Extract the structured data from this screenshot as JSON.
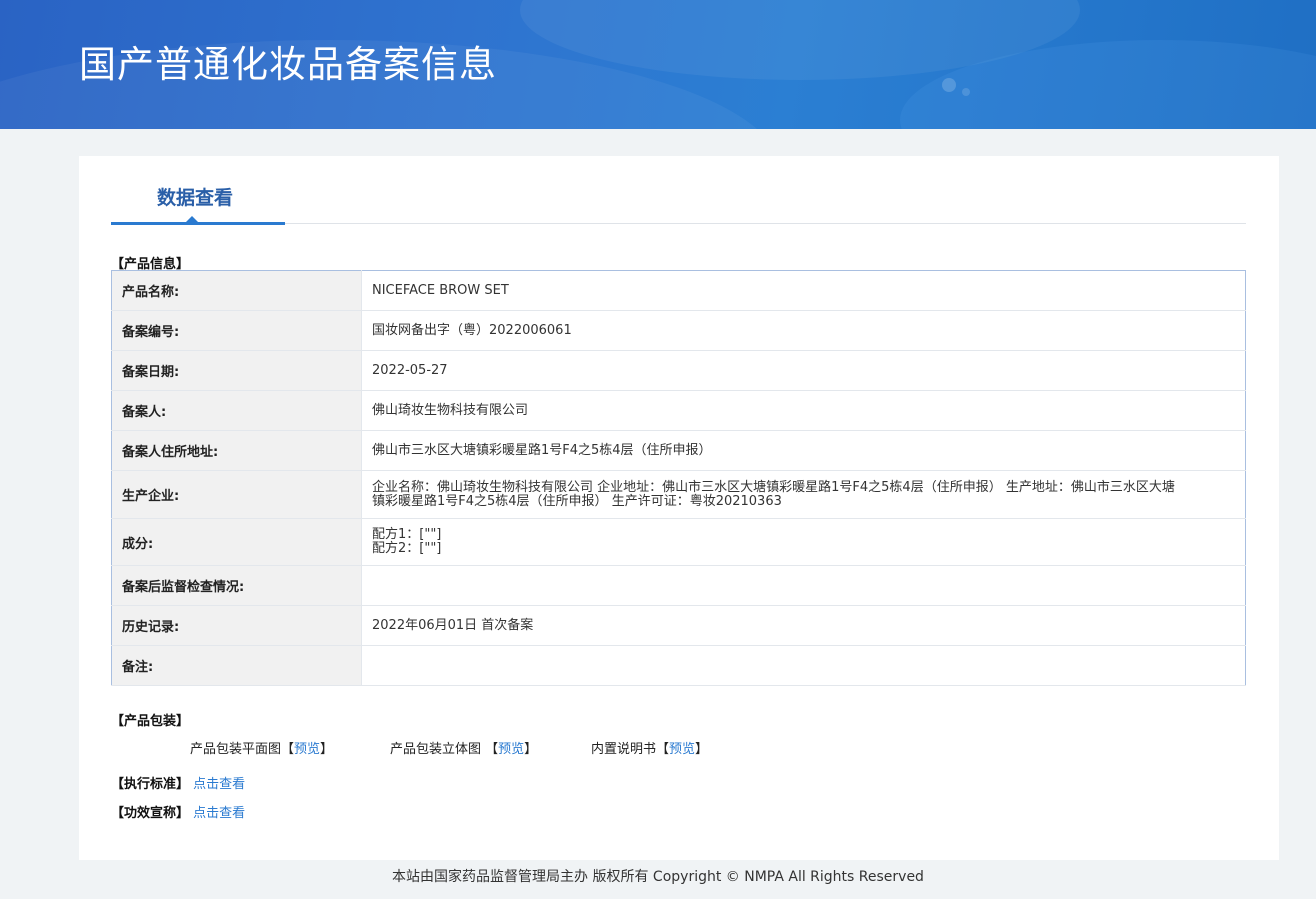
{
  "header": {
    "title": "国产普通化妆品备案信息"
  },
  "tab": {
    "label": "数据查看"
  },
  "product_info": {
    "section_title": "【产品信息】",
    "rows": [
      {
        "key": "产品名称:",
        "value": "NICEFACE BROW SET"
      },
      {
        "key": "备案编号:",
        "value": "国妆网备出字（粤）2022006061"
      },
      {
        "key": "备案日期:",
        "value": "2022-05-27"
      },
      {
        "key": "备案人:",
        "value": "佛山琦妆生物科技有限公司"
      },
      {
        "key": "备案人住所地址:",
        "value": "佛山市三水区大塘镇彩暖星路1号F4之5栋4层（住所申报）"
      },
      {
        "key": "生产企业:",
        "value": "企业名称：佛山琦妆生物科技有限公司 企业地址：佛山市三水区大塘镇彩暖星路1号F4之5栋4层（住所申报） 生产地址：佛山市三水区大塘镇彩暖星路1号F4之5栋4层（住所申报） 生产许可证：粤妆20210363"
      },
      {
        "key": "成分:",
        "value_lines": [
          "配方1：[\"\"]",
          "配方2：[\"\"]"
        ]
      },
      {
        "key": "备案后监督检查情况:",
        "value": ""
      },
      {
        "key": "历史记录:",
        "value": "2022年06月01日 首次备案"
      },
      {
        "key": "备注:",
        "value": ""
      }
    ]
  },
  "packaging": {
    "section_title": "【产品包装】",
    "items": [
      {
        "label": "产品包装平面图",
        "lb": "【",
        "link": "预览",
        "rb": "】"
      },
      {
        "label": "产品包装立体图 ",
        "lb": "【",
        "link": "预览",
        "rb": "】"
      },
      {
        "label": "内置说明书",
        "lb": "【",
        "link": "预览",
        "rb": "】"
      }
    ]
  },
  "standard": {
    "label": "【执行标准】",
    "link": "点击查看"
  },
  "efficacy": {
    "label": "【功效宣称】",
    "link": "点击查看"
  },
  "footer": {
    "text": "本站由国家药品监督管理局主办 版权所有 Copyright © NMPA All Rights Reserved"
  }
}
